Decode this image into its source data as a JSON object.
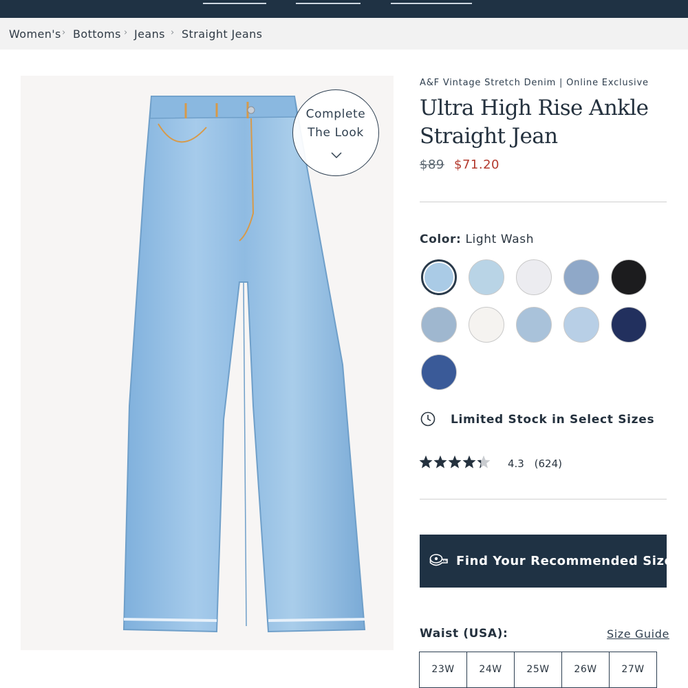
{
  "breadcrumb": [
    "Women's",
    "Bottoms",
    "Jeans",
    "Straight Jeans"
  ],
  "complete_look": {
    "line1": "Complete",
    "line2": "The Look"
  },
  "product": {
    "brand_line": "A&F Vintage Stretch Denim | Online Exclusive",
    "title": "Ultra High Rise Ankle Straight Jean",
    "price_original": "$89",
    "price_sale": "$71.20",
    "price_sale_color": "#b33a2e"
  },
  "color": {
    "label": "Color:",
    "selected": "Light Wash",
    "swatches": [
      "#aacbe6",
      "#b9d4e6",
      "#ececf0",
      "#8fa8c8",
      "#1c1c1e",
      "#9fb7cf",
      "#f5f3f0",
      "#a9c2da",
      "#b8cfe6",
      "#22305e",
      "#3a5a98"
    ]
  },
  "stock": {
    "icon": "clock-icon",
    "text": "Limited Stock in Select Sizes"
  },
  "rating": {
    "score": 4.3,
    "score_text": "4.3",
    "count_text": "(624)"
  },
  "find_size": {
    "icon": "measuring-tape-icon",
    "label": "Find Your Recommended Size"
  },
  "sizing": {
    "waist_label": "Waist (USA):",
    "guide_label": "Size Guide",
    "waist_sizes": [
      "23W",
      "24W",
      "25W",
      "26W",
      "27W"
    ]
  },
  "colors": {
    "navy": "#1f3244",
    "accent": "#b33a2e"
  }
}
